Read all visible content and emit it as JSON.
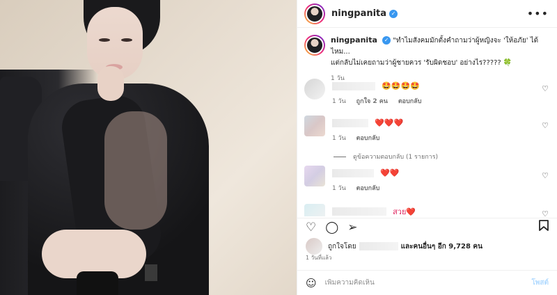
{
  "header": {
    "username": "ningpanita",
    "more_icon": "more-horizontal-icon"
  },
  "caption": {
    "username": "ningpanita",
    "text_line1": "\"ทำไมสังคมมักตั้งคำถามว่าผู้หญิงจะ 'ให้อภัย' ได้ไหม...",
    "text_line2": "แต่กลับไม่เคยถามว่าผู้ชายควร 'รับผิดชอบ' อย่างไร????? 🍀",
    "time": "1 วัน"
  },
  "comments": [
    {
      "emoji": "🤩🤩🤩🤩",
      "time": "1 วัน",
      "likes": "ถูกใจ 2 คน",
      "reply": "ตอบกลับ"
    },
    {
      "emoji": "❤️❤️❤️",
      "time": "1 วัน",
      "reply": "ตอบกลับ"
    },
    {
      "emoji": "❤️❤️",
      "time": "1 วัน",
      "reply": "ตอบกลับ"
    },
    {
      "emoji": "สวย❤️"
    }
  ],
  "view_replies": "ดูข้อความตอบกลับ (1 รายการ)",
  "likes": {
    "prefix": "ถูกใจโดย",
    "suffix": "และคนอื่นๆ อีก 9,728 คน"
  },
  "post_time": "1 วันที่แล้ว",
  "add_comment": {
    "placeholder": "เพิ่มความคิดเห็น",
    "post_label": "โพสต์"
  },
  "colors": {
    "accent": "#3897f0",
    "post_button": "#b3dbff",
    "muted": "#737373"
  }
}
